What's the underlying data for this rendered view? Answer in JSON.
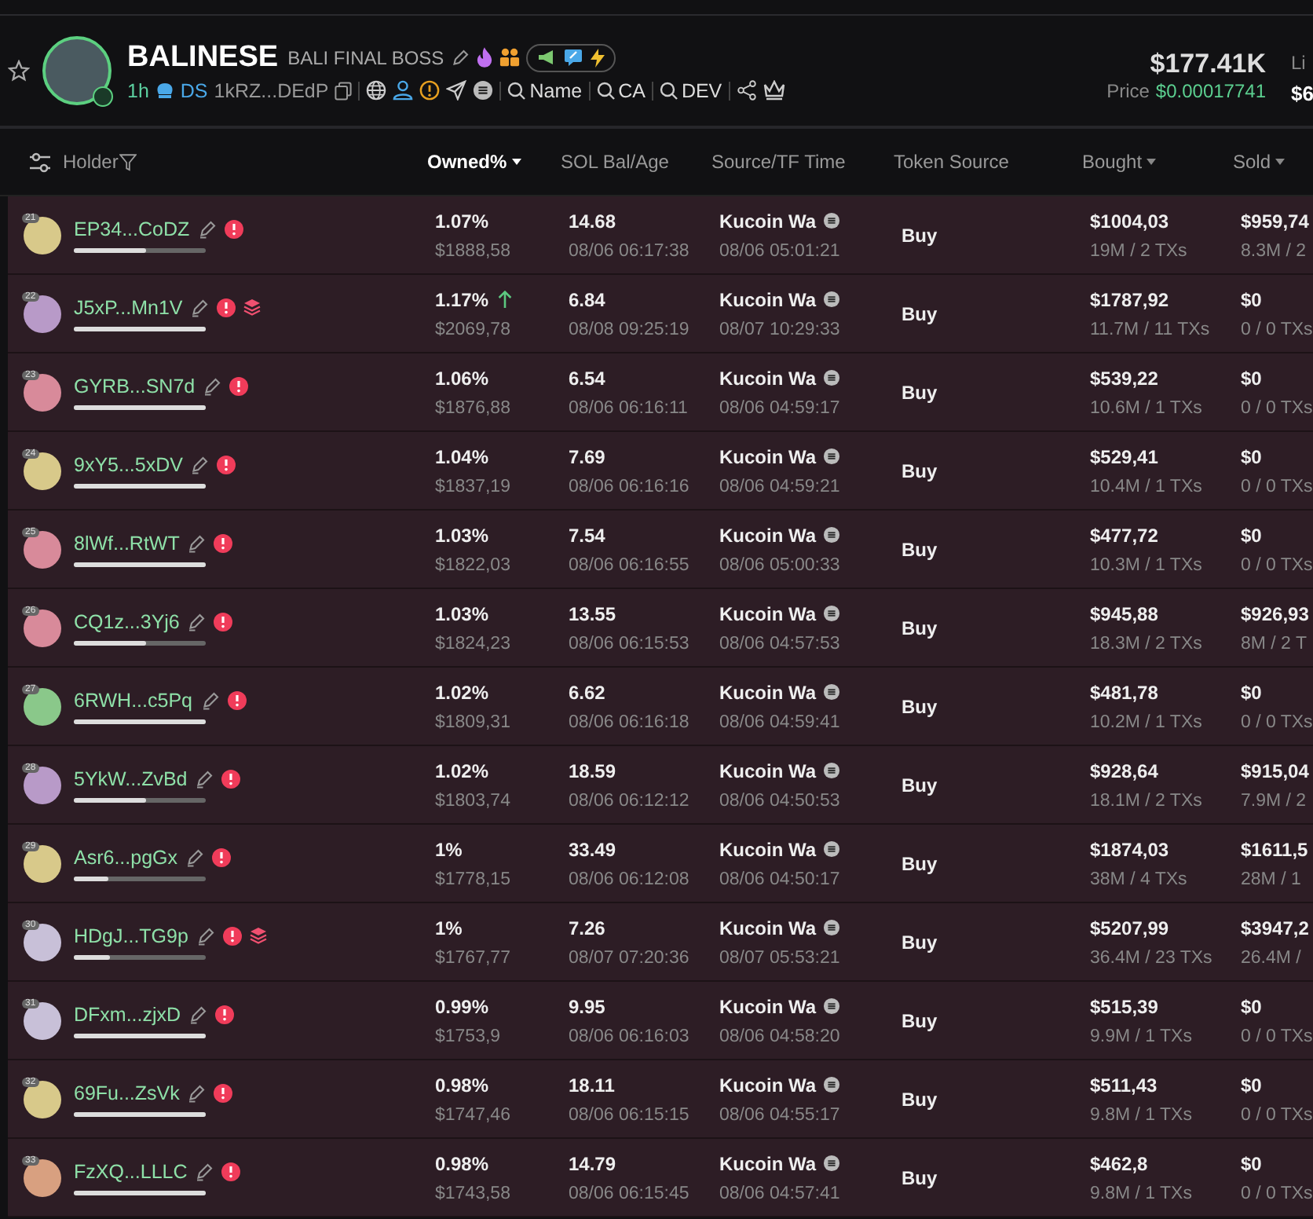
{
  "token": {
    "name": "BALINESE",
    "subtitle": "BALI FINAL BOSS",
    "age": "1h",
    "ds": "DS",
    "address": "1kRZ...DEdP",
    "searches": [
      "Name",
      "CA",
      "DEV"
    ],
    "market_cap": "$177.41K",
    "price_label": "Price",
    "price": "$0.00017741",
    "liquidity_label": "Li",
    "liquidity": "$6"
  },
  "columns": [
    {
      "label": "Holder",
      "sortable": false,
      "active": false
    },
    {
      "label": "Owned%",
      "sortable": true,
      "active": true
    },
    {
      "label": "SOL Bal/Age",
      "sortable": false,
      "active": false
    },
    {
      "label": "Source/TF Time",
      "sortable": false,
      "active": false
    },
    {
      "label": "Token Source",
      "sortable": false,
      "active": false
    },
    {
      "label": "Bought",
      "sortable": true,
      "active": false
    },
    {
      "label": "Sold",
      "sortable": true,
      "active": false
    }
  ],
  "rows": [
    {
      "rank": "21",
      "color": "#d8c98a",
      "name": "EP34...CoDZ",
      "level": 0.55,
      "bundled": false,
      "owned": "1.07%",
      "increased": false,
      "owned_usd": "$1888,58",
      "sol": "14.68",
      "sol_age": "08/06 06:17:38",
      "source": "Kucoin Wa",
      "source_time": "08/06 05:01:21",
      "token_source": "Buy",
      "bought": "$1004,03",
      "bought_sub": "19M / 2 TXs",
      "sold": "$959,74",
      "sold_sub": "8.3M / 2"
    },
    {
      "rank": "22",
      "color": "#b89ac8",
      "name": "J5xP...Mn1V",
      "level": 1,
      "bundled": true,
      "owned": "1.17%",
      "increased": true,
      "owned_usd": "$2069,78",
      "sol": "6.84",
      "sol_age": "08/08 09:25:19",
      "source": "Kucoin Wa",
      "source_time": "08/07 10:29:33",
      "token_source": "Buy",
      "bought": "$1787,92",
      "bought_sub": "11.7M / 11 TXs",
      "sold": "$0",
      "sold_sub": "0 / 0 TXs"
    },
    {
      "rank": "23",
      "color": "#d88a9a",
      "name": "GYRB...SN7d",
      "level": 1,
      "bundled": false,
      "owned": "1.06%",
      "increased": false,
      "owned_usd": "$1876,88",
      "sol": "6.54",
      "sol_age": "08/06 06:16:11",
      "source": "Kucoin Wa",
      "source_time": "08/06 04:59:17",
      "token_source": "Buy",
      "bought": "$539,22",
      "bought_sub": "10.6M / 1 TXs",
      "sold": "$0",
      "sold_sub": "0 / 0 TXs"
    },
    {
      "rank": "24",
      "color": "#d8c98a",
      "name": "9xY5...5xDV",
      "level": 1,
      "bundled": false,
      "owned": "1.04%",
      "increased": false,
      "owned_usd": "$1837,19",
      "sol": "7.69",
      "sol_age": "08/06 06:16:16",
      "source": "Kucoin Wa",
      "source_time": "08/06 04:59:21",
      "token_source": "Buy",
      "bought": "$529,41",
      "bought_sub": "10.4M / 1 TXs",
      "sold": "$0",
      "sold_sub": "0 / 0 TXs"
    },
    {
      "rank": "25",
      "color": "#d88a9a",
      "name": "8lWf...RtWT",
      "level": 1,
      "bundled": false,
      "owned": "1.03%",
      "increased": false,
      "owned_usd": "$1822,03",
      "sol": "7.54",
      "sol_age": "08/06 06:16:55",
      "source": "Kucoin Wa",
      "source_time": "08/06 05:00:33",
      "token_source": "Buy",
      "bought": "$477,72",
      "bought_sub": "10.3M / 1 TXs",
      "sold": "$0",
      "sold_sub": "0 / 0 TXs"
    },
    {
      "rank": "26",
      "color": "#d88a9a",
      "name": "CQ1z...3Yj6",
      "level": 0.55,
      "bundled": false,
      "owned": "1.03%",
      "increased": false,
      "owned_usd": "$1824,23",
      "sol": "13.55",
      "sol_age": "08/06 06:15:53",
      "source": "Kucoin Wa",
      "source_time": "08/06 04:57:53",
      "token_source": "Buy",
      "bought": "$945,88",
      "bought_sub": "18.3M / 2 TXs",
      "sold": "$926,93",
      "sold_sub": "8M / 2 T"
    },
    {
      "rank": "27",
      "color": "#8ac88a",
      "name": "6RWH...c5Pq",
      "level": 1,
      "bundled": false,
      "owned": "1.02%",
      "increased": false,
      "owned_usd": "$1809,31",
      "sol": "6.62",
      "sol_age": "08/06 06:16:18",
      "source": "Kucoin Wa",
      "source_time": "08/06 04:59:41",
      "token_source": "Buy",
      "bought": "$481,78",
      "bought_sub": "10.2M / 1 TXs",
      "sold": "$0",
      "sold_sub": "0 / 0 TXs"
    },
    {
      "rank": "28",
      "color": "#b89ac8",
      "name": "5YkW...ZvBd",
      "level": 0.55,
      "bundled": false,
      "owned": "1.02%",
      "increased": false,
      "owned_usd": "$1803,74",
      "sol": "18.59",
      "sol_age": "08/06 06:12:12",
      "source": "Kucoin Wa",
      "source_time": "08/06 04:50:53",
      "token_source": "Buy",
      "bought": "$928,64",
      "bought_sub": "18.1M / 2 TXs",
      "sold": "$915,04",
      "sold_sub": "7.9M / 2"
    },
    {
      "rank": "29",
      "color": "#d8c98a",
      "name": "Asr6...pgGx",
      "level": 0.26,
      "bundled": false,
      "owned": "1%",
      "increased": false,
      "owned_usd": "$1778,15",
      "sol": "33.49",
      "sol_age": "08/06 06:12:08",
      "source": "Kucoin Wa",
      "source_time": "08/06 04:50:17",
      "token_source": "Buy",
      "bought": "$1874,03",
      "bought_sub": "38M / 4 TXs",
      "sold": "$1611,5",
      "sold_sub": "28M / 1"
    },
    {
      "rank": "30",
      "color": "#c8c0d8",
      "name": "HDgJ...TG9p",
      "level": 0.27,
      "bundled": true,
      "owned": "1%",
      "increased": false,
      "owned_usd": "$1767,77",
      "sol": "7.26",
      "sol_age": "08/07 07:20:36",
      "source": "Kucoin Wa",
      "source_time": "08/07 05:53:21",
      "token_source": "Buy",
      "bought": "$5207,99",
      "bought_sub": "36.4M / 23 TXs",
      "sold": "$3947,2",
      "sold_sub": "26.4M /"
    },
    {
      "rank": "31",
      "color": "#c8c0d8",
      "name": "DFxm...zjxD",
      "level": 1,
      "bundled": false,
      "owned": "0.99%",
      "increased": false,
      "owned_usd": "$1753,9",
      "sol": "9.95",
      "sol_age": "08/06 06:16:03",
      "source": "Kucoin Wa",
      "source_time": "08/06 04:58:20",
      "token_source": "Buy",
      "bought": "$515,39",
      "bought_sub": "9.9M / 1 TXs",
      "sold": "$0",
      "sold_sub": "0 / 0 TXs"
    },
    {
      "rank": "32",
      "color": "#d8c98a",
      "name": "69Fu...ZsVk",
      "level": 1,
      "bundled": false,
      "owned": "0.98%",
      "increased": false,
      "owned_usd": "$1747,46",
      "sol": "18.11",
      "sol_age": "08/06 06:15:15",
      "source": "Kucoin Wa",
      "source_time": "08/06 04:55:17",
      "token_source": "Buy",
      "bought": "$511,43",
      "bought_sub": "9.8M / 1 TXs",
      "sold": "$0",
      "sold_sub": "0 / 0 TXs"
    },
    {
      "rank": "33",
      "color": "#d8a080",
      "name": "FzXQ...LLLC",
      "level": 1,
      "bundled": false,
      "owned": "0.98%",
      "increased": false,
      "owned_usd": "$1743,58",
      "sol": "14.79",
      "sol_age": "08/06 06:15:45",
      "source": "Kucoin Wa",
      "source_time": "08/06 04:57:41",
      "token_source": "Buy",
      "bought": "$462,8",
      "bought_sub": "9.8M / 1 TXs",
      "sold": "$0",
      "sold_sub": "0 / 0 TXs"
    }
  ]
}
